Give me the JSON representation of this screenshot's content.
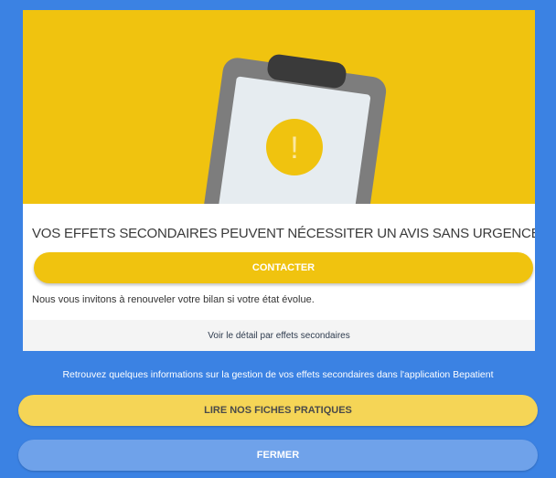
{
  "alert": {
    "headline": "VOS EFFETS SECONDAIRES PEUVENT NÉCESSITER UN AVIS SANS URGENCE.",
    "contact_label": "CONTACTER",
    "info_text": "Nous vous invitons à renouveler votre bilan si votre état évolue.",
    "detail_link": "Voir le détail par effets secondaires",
    "illustration_icon": "clipboard-warning-icon",
    "warning_glyph": "!"
  },
  "footer": {
    "promo_text": "Retrouvez quelques informations sur la gestion de vos effets secondaires dans l'application Bepatient",
    "read_label": "LIRE NOS FICHES PRATIQUES",
    "close_label": "FERMER"
  },
  "colors": {
    "background_blue": "#3b82e3",
    "accent_yellow": "#f0c30f",
    "light_yellow": "#f5d556",
    "light_blue": "#6fa2ea",
    "clipboard_gray": "#7d7d7d",
    "paper": "#e6ecf0"
  }
}
